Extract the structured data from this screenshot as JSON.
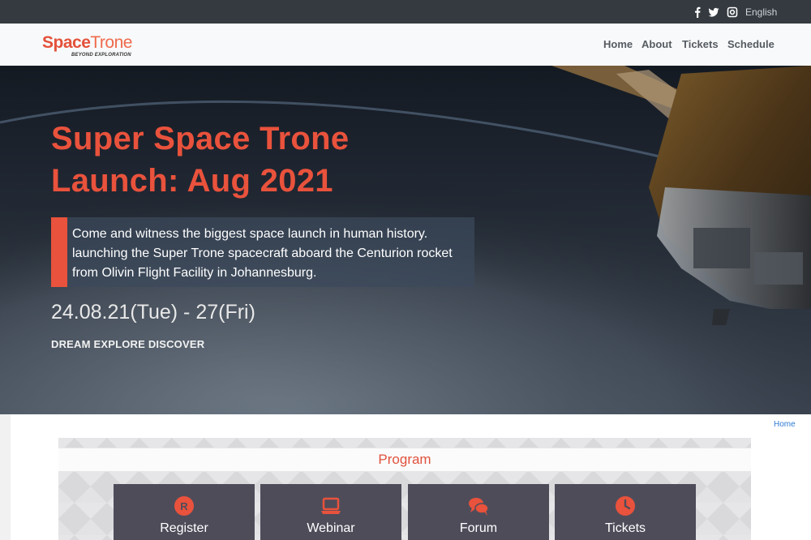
{
  "topbar": {
    "language": "English",
    "icons": [
      "facebook-icon",
      "twitter-icon",
      "instagram-icon"
    ]
  },
  "header": {
    "logo_text_a": "Space",
    "logo_text_b": "Trone",
    "logo_tagline": "BEYOND EXPLORATION",
    "nav": [
      "Home",
      "About",
      "Tickets",
      "Schedule"
    ]
  },
  "hero": {
    "title_line1": "Super Space Trone",
    "title_line2": "Launch: Aug 2021",
    "description_lines": [
      "Come and witness the biggest space launch in human history.",
      "launching the Super Trone spacecraft aboard the Centurion rocket",
      "from Olivin Flight Facility in Johannesburg."
    ],
    "date": "24.08.21(Tue) - 27(Fri)",
    "motto": "DREAM EXPLORE DISCOVER"
  },
  "breadcrumb": "Home",
  "program": {
    "title": "Program",
    "cards": [
      {
        "label": "Register",
        "icon": "register-icon"
      },
      {
        "label": "Webinar",
        "icon": "laptop-icon"
      },
      {
        "label": "Forum",
        "icon": "chat-bubbles-icon"
      },
      {
        "label": "Tickets",
        "icon": "clock-icon"
      }
    ]
  },
  "colors": {
    "accent": "#e9523c",
    "topbar": "#343a40",
    "card": "#4f4c5a"
  }
}
